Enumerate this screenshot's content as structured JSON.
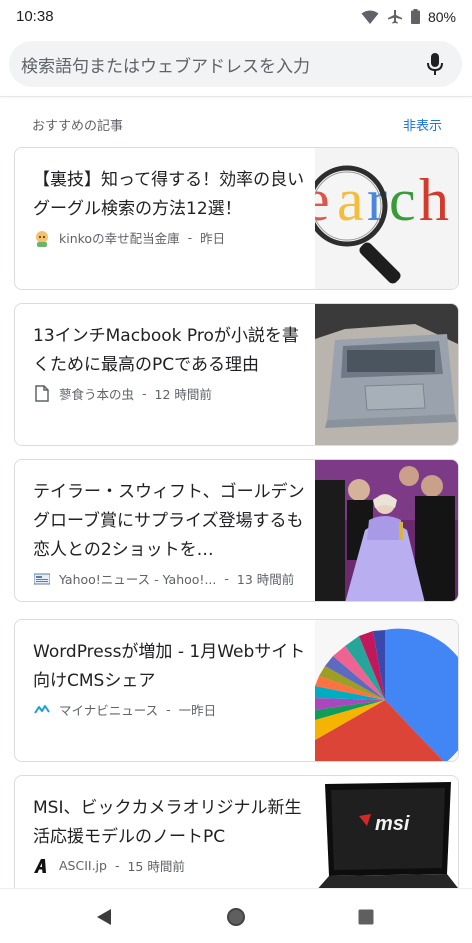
{
  "status_bar": {
    "time": "10:38",
    "battery": "80%",
    "icons": [
      "wifi-icon",
      "airplane-icon",
      "battery-icon"
    ]
  },
  "search": {
    "placeholder": "検索語句またはウェブアドレスを入力",
    "mic_icon": "microphone-icon"
  },
  "feed": {
    "section_title": "おすすめの記事",
    "hide_label": "非表示",
    "articles": [
      {
        "title": "【裏技】知って得する！効率の良いグーグル検索の方法12選！",
        "source": "kinkoの幸せ配当金庫",
        "time": "昨日",
        "source_icon": "kinko-avatar-icon",
        "thumbnail": "search-magnifier-image"
      },
      {
        "title": "13インチMacbook Proが小説を書くために最高のPCである理由",
        "source": "蓼食う本の虫",
        "time": "12 時間前",
        "source_icon": "document-icon",
        "thumbnail": "macbook-image"
      },
      {
        "title": "テイラー・スウィフト、ゴールデングローブ賞にサプライズ登場するも恋人との2ショットを…",
        "source": "Yahoo!ニュース - Yahoo!...",
        "time": "13 時間前",
        "source_icon": "yahoo-news-icon",
        "thumbnail": "golden-globe-photo"
      },
      {
        "title": "WordPressが増加 - 1月Webサイト向けCMSシェア",
        "source": "マイナビニュース",
        "time": "一昨日",
        "source_icon": "mynavi-icon",
        "thumbnail": "cms-pie-chart-image"
      },
      {
        "title": "MSI、ビックカメラオリジナル新生活応援モデルのノートPC",
        "source": "ASCII.jp",
        "time": "15 時間前",
        "source_icon": "ascii-logo-icon",
        "thumbnail": "msi-laptop-image"
      }
    ]
  },
  "nav": {
    "back_icon": "back-triangle-icon",
    "home_icon": "home-circle-icon",
    "recents_icon": "recents-square-icon"
  },
  "colors": {
    "accent": "#1a73e8",
    "search_bg": "#f1f3f4",
    "card_border": "#dadce0"
  }
}
